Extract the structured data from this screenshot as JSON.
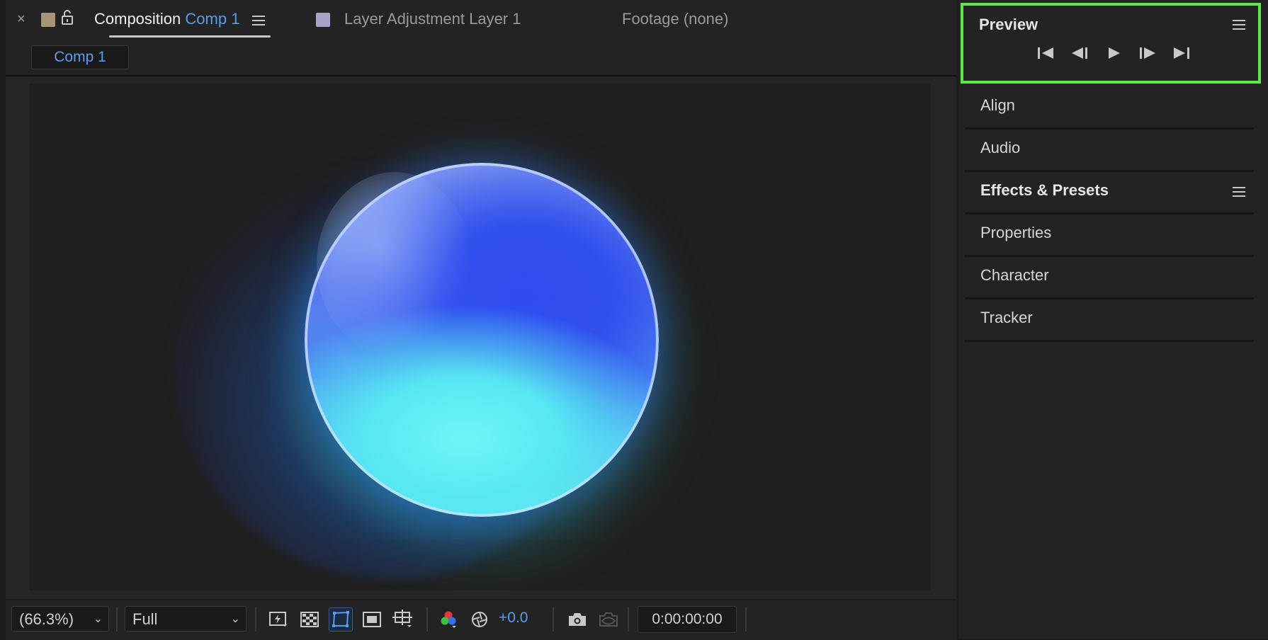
{
  "tabs": {
    "composition": {
      "prefix": "Composition",
      "name": "Comp 1",
      "swatch": "#a89479"
    },
    "layer": {
      "label": "Layer Adjustment Layer 1",
      "swatch": "#a8a4c8"
    },
    "footage": {
      "label": "Footage (none)"
    }
  },
  "subtab": {
    "label": "Comp 1"
  },
  "toolbar": {
    "zoom": "(66.3%)",
    "resolution": "Full",
    "exposure": "+0.0",
    "timecode": "0:00:00:00"
  },
  "right_panel": {
    "preview": {
      "title": "Preview",
      "highlight_color": "#5ee84a"
    },
    "items": [
      {
        "label": "Align"
      },
      {
        "label": "Audio"
      },
      {
        "label": "Effects & Presets",
        "has_menu": true
      },
      {
        "label": "Properties"
      },
      {
        "label": "Character"
      },
      {
        "label": "Tracker"
      }
    ]
  },
  "colors": {
    "accent": "#5a9bf0",
    "highlight": "#5ee84a"
  }
}
